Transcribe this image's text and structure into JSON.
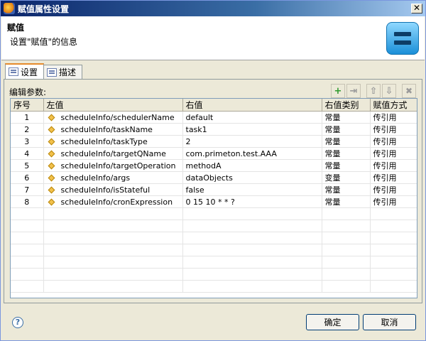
{
  "window": {
    "title": "赋值属性设置",
    "close_glyph": "✕"
  },
  "banner": {
    "title": "赋值",
    "description": "设置\"赋值\"的信息"
  },
  "tabs": [
    {
      "label": "设置"
    },
    {
      "label": "描述"
    }
  ],
  "panel": {
    "label": "编辑参数:"
  },
  "toolbar": [
    {
      "name": "add-icon",
      "glyph": "+"
    },
    {
      "name": "insert-icon",
      "glyph": "⇥"
    },
    {
      "name": "move-up-icon",
      "glyph": "⇧"
    },
    {
      "name": "move-down-icon",
      "glyph": "⇩"
    },
    {
      "name": "delete-icon",
      "glyph": "✖"
    }
  ],
  "table": {
    "columns": [
      "序号",
      "左值",
      "右值",
      "右值类别",
      "赋值方式"
    ],
    "rows": [
      {
        "no": "1",
        "left": "scheduleInfo/schedulerName",
        "right": "default",
        "type": "常量",
        "mode": "传引用"
      },
      {
        "no": "2",
        "left": "scheduleInfo/taskName",
        "right": "task1",
        "type": "常量",
        "mode": "传引用"
      },
      {
        "no": "3",
        "left": "scheduleInfo/taskType",
        "right": "2",
        "type": "常量",
        "mode": "传引用"
      },
      {
        "no": "4",
        "left": "scheduleInfo/targetQName",
        "right": "com.primeton.test.AAA",
        "type": "常量",
        "mode": "传引用"
      },
      {
        "no": "5",
        "left": "scheduleInfo/targetOperation",
        "right": "methodA",
        "type": "常量",
        "mode": "传引用"
      },
      {
        "no": "6",
        "left": "scheduleInfo/args",
        "right": "dataObjects",
        "type": "变量",
        "mode": "传引用"
      },
      {
        "no": "7",
        "left": "scheduleInfo/isStateful",
        "right": "false",
        "type": "常量",
        "mode": "传引用"
      },
      {
        "no": "8",
        "left": "scheduleInfo/cronExpression",
        "right": "0 15 10 * * ?",
        "type": "常量",
        "mode": "传引用"
      }
    ]
  },
  "footer": {
    "help_glyph": "?",
    "ok_label": "确定",
    "cancel_label": "取消"
  }
}
